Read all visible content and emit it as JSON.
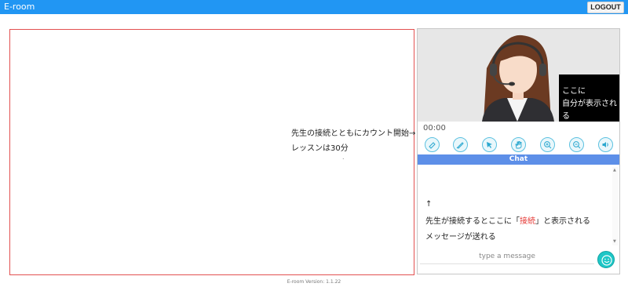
{
  "header": {
    "title": "E-room",
    "logout_label": "LOGOUT"
  },
  "board": {
    "note_line1": "先生の接続とともにカウント開始→",
    "note_line2": "レッスンは30分",
    "dot": "."
  },
  "video": {
    "self_line1": "ここに",
    "self_line2": "自分が表示される"
  },
  "timer": "00:00",
  "tools": [
    {
      "icon": "eraser-icon"
    },
    {
      "icon": "pen-icon"
    },
    {
      "icon": "pointer-icon"
    },
    {
      "icon": "hand-icon"
    },
    {
      "icon": "zoom-in-icon"
    },
    {
      "icon": "zoom-out-icon"
    },
    {
      "icon": "speaker-icon"
    }
  ],
  "chat": {
    "title": "Chat",
    "arrow": "↑",
    "line1_pre": "先生が接続するとここに「",
    "line1_red": "接続",
    "line1_post": "」と表示される",
    "line2": "メッセージが送れる",
    "placeholder": "type a message"
  },
  "footer": "E-room Version: 1.1.22",
  "colors": {
    "topbar": "#2196f3",
    "accent": "#5d8fe8",
    "border": "#e25151",
    "emoji": "#1ec7c7"
  }
}
